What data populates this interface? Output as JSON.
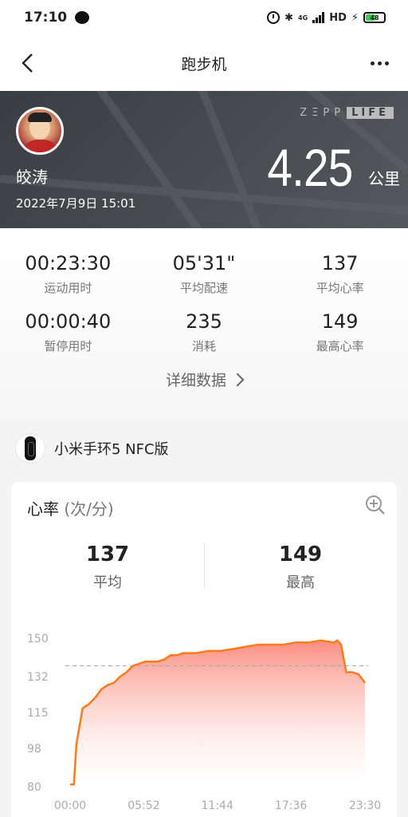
{
  "status": {
    "time": "17:10",
    "network": "4G",
    "hd": "HD",
    "battery": "48"
  },
  "nav": {
    "title": "跑步机"
  },
  "hero": {
    "brand_zepp": "ZΞPP",
    "brand_life": "LIFE",
    "user_name": "皎涛",
    "datetime": "2022年7月9日 15:01",
    "distance": "4.25",
    "distance_unit": "公里"
  },
  "stats": [
    {
      "value": "00:23:30",
      "label": "运动用时"
    },
    {
      "value": "05'31\"",
      "label": "平均配速"
    },
    {
      "value": "137",
      "label": "平均心率"
    },
    {
      "value": "00:00:40",
      "label": "暂停用时"
    },
    {
      "value": "235",
      "label": "消耗"
    },
    {
      "value": "149",
      "label": "最高心率"
    }
  ],
  "detail_link": "详细数据",
  "device": {
    "name": "小米手环5 NFC版"
  },
  "hr": {
    "title": "心率",
    "unit": "(次/分)",
    "avg_value": "137",
    "avg_label": "平均",
    "max_value": "149",
    "max_label": "最高"
  },
  "colors": {
    "line": "#ff7a1a",
    "fill_top": "#fb7a6a",
    "fill_bottom": "#ffffff",
    "hero_bg": "#3a3d42"
  },
  "chart_data": {
    "type": "area",
    "ylim": [
      80,
      150
    ],
    "yticks": [
      "150",
      "132",
      "115",
      "98",
      "80"
    ],
    "xticks": [
      "00:00",
      "05:52",
      "11:44",
      "17:36",
      "23:30"
    ],
    "average_line": 137,
    "series": [
      {
        "x": [
          0,
          0.3,
          0.5,
          1.0,
          1.5,
          2.0,
          2.5,
          3.0,
          3.5,
          4.0,
          4.5,
          5.0,
          5.5,
          6.0,
          6.5,
          7.0,
          7.5,
          8.0,
          8.5,
          9.0,
          10.0,
          11.0,
          12.0,
          13.0,
          14.0,
          15.0,
          16.0,
          17.0,
          18.0,
          19.0,
          20.0,
          21.0,
          21.3,
          21.6,
          22.0,
          22.5,
          23.0,
          23.5
        ],
        "values": [
          81,
          81,
          100,
          117,
          119,
          122,
          126,
          128,
          129,
          132,
          134,
          137,
          138,
          139,
          139,
          139,
          140,
          142,
          142,
          143,
          143,
          144,
          144,
          145,
          146,
          147,
          147,
          147,
          148,
          148,
          149,
          148,
          149,
          147,
          134,
          134,
          133,
          129
        ]
      }
    ]
  }
}
